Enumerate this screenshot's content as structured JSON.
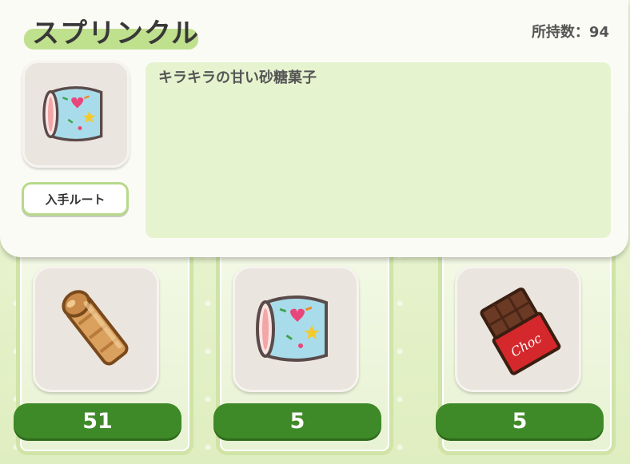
{
  "item_detail": {
    "name": "スプリンクル",
    "owned_label": "所持数：94",
    "description": "キラキラの甘い砂糖菓子",
    "route_button_label": "入手ルート",
    "icon": "sprinkle-roll-icon"
  },
  "inventory": [
    {
      "icon": "cream-roll-icon",
      "count": "51"
    },
    {
      "icon": "sprinkle-roll-icon",
      "count": "5"
    },
    {
      "icon": "chocolate-bar-icon",
      "count": "5"
    }
  ],
  "colors": {
    "accent_green": "#3f8a28",
    "title_highlight": "#bfe08d",
    "desc_bg": "#e6f3cf"
  }
}
